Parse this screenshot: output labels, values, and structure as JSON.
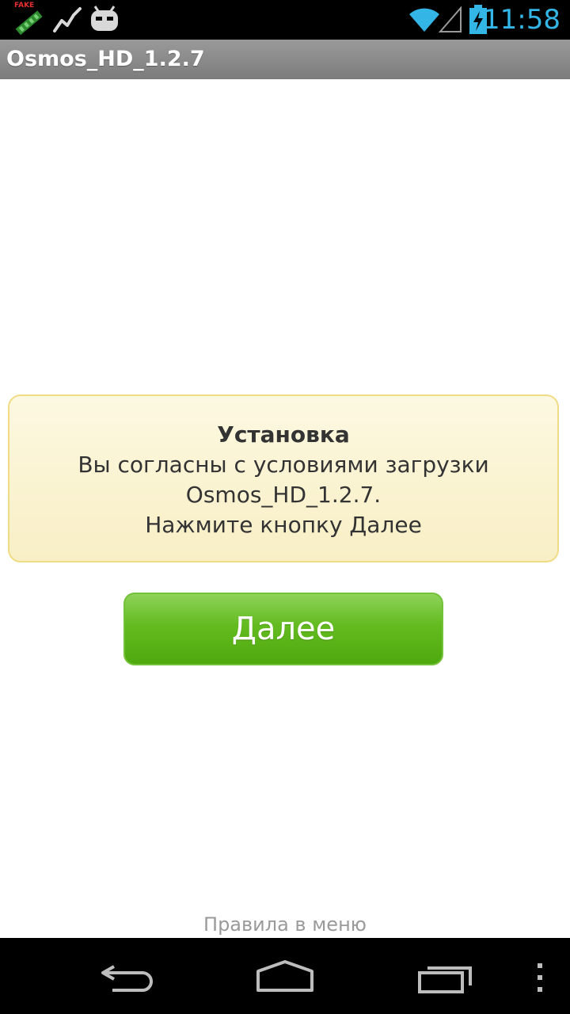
{
  "status_bar": {
    "time": "11:58",
    "fake_badge": "FAKE",
    "icons": [
      "fake-gps-icon",
      "activity-graph-icon",
      "cyanogen-mascot-icon",
      "wifi-icon",
      "signal-icon",
      "battery-charging-icon"
    ],
    "accent_color": "#33b5e5"
  },
  "title_bar": {
    "title": "Osmos_HD_1.2.7"
  },
  "notice": {
    "heading": "Установка",
    "line1": "Вы согласны с условиями загрузки",
    "line2": "Osmos_HD_1.2.7.",
    "line3": "Нажмите кнопку Далее",
    "background_color": "#fbf4d4",
    "border_color": "#f1dc86"
  },
  "next_button": {
    "label": "Далее",
    "color": "#5db81a"
  },
  "rules_link": {
    "label": "Правила в меню"
  },
  "nav_bar": {
    "icons": [
      "back-icon",
      "home-icon",
      "recent-apps-icon",
      "menu-icon"
    ]
  }
}
